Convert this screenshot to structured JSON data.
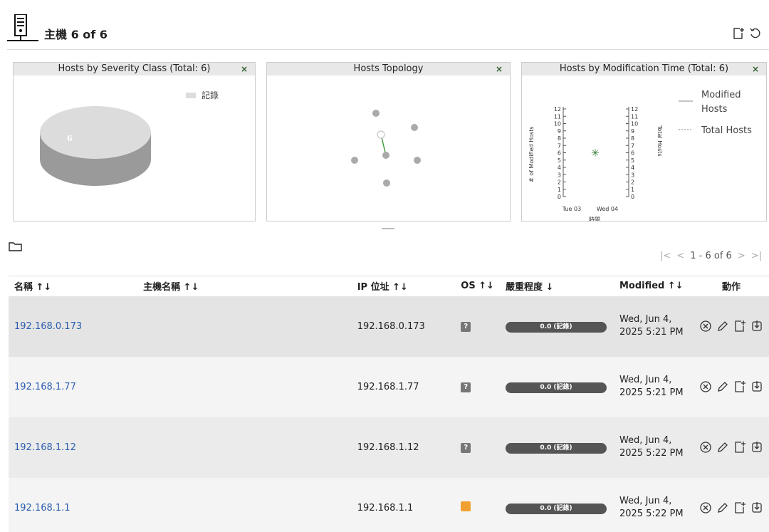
{
  "header": {
    "title": "主機 6 of 6",
    "icon": "host-server-icon",
    "actions": [
      "new-host-icon",
      "refresh-icon"
    ]
  },
  "dashboard": {
    "severity": {
      "title": "Hosts by Severity Class (Total: 6)",
      "close": "×",
      "legend": "記錄",
      "slice_label": "6"
    },
    "topology": {
      "title": "Hosts Topology",
      "close": "×"
    },
    "modification": {
      "title": "Hosts by Modification Time (Total: 6)",
      "close": "×",
      "legend_modified": "Modified Hosts",
      "legend_total": "Total Hosts",
      "y_label_left": "# of Modified Hosts",
      "y_label_right": "Total Hosts",
      "x_label": "時間",
      "x_ticks": [
        "Tue 03",
        "Wed 04"
      ]
    }
  },
  "chart_data": {
    "type": "line",
    "title": "Hosts by Modification Time (Total: 6)",
    "xlabel": "時間",
    "ylabel": "# of Modified Hosts",
    "y2label": "Total Hosts",
    "categories": [
      "Tue 03",
      "Wed 04"
    ],
    "ylim": [
      0,
      12
    ],
    "y_ticks": [
      0,
      1,
      2,
      3,
      4,
      5,
      6,
      7,
      8,
      9,
      10,
      11,
      12
    ],
    "series": [
      {
        "name": "Modified Hosts",
        "style": "solid",
        "values": []
      },
      {
        "name": "Total Hosts",
        "style": "dotted",
        "values": []
      }
    ],
    "markers": [
      {
        "y": 6
      }
    ]
  },
  "pagination": {
    "range": "1 - 6 of 6",
    "first": "|<",
    "prev": "<",
    "next": ">",
    "last": ">|"
  },
  "table": {
    "columns": {
      "name": "名稱 ↑↓",
      "hostname": "主機名稱 ↑↓",
      "ip": "IP 位址 ↑↓",
      "os": "OS ↑↓",
      "severity": "嚴重程度 ↓",
      "modified": "Modified ↑↓",
      "actions": "動作"
    },
    "rows": [
      {
        "name": "192.168.0.173",
        "hostname": "",
        "ip": "192.168.0.173",
        "os": "?",
        "severity": "0.0 (記錄)",
        "modified": "Wed, Jun 4, 2025 5:21 PM"
      },
      {
        "name": "192.168.1.77",
        "hostname": "",
        "ip": "192.168.1.77",
        "os": "?",
        "severity": "0.0 (記錄)",
        "modified": "Wed, Jun 4, 2025 5:21 PM"
      },
      {
        "name": "192.168.1.12",
        "hostname": "",
        "ip": "192.168.1.12",
        "os": "?",
        "severity": "0.0 (記錄)",
        "modified": "Wed, Jun 4, 2025 5:22 PM"
      },
      {
        "name": "192.168.1.1",
        "hostname": "",
        "ip": "192.168.1.1",
        "os": "",
        "severity": "0.0 (記錄)",
        "modified": "Wed, Jun 4, 2025 5:22 PM"
      }
    ]
  },
  "colors": {
    "link": "#2a5db0",
    "severity_bar": "#555555",
    "os_unknown": "#777777",
    "os_router": "#f0a030",
    "topology_edge": "#3a9a3a",
    "marker": "#2e7d32"
  }
}
